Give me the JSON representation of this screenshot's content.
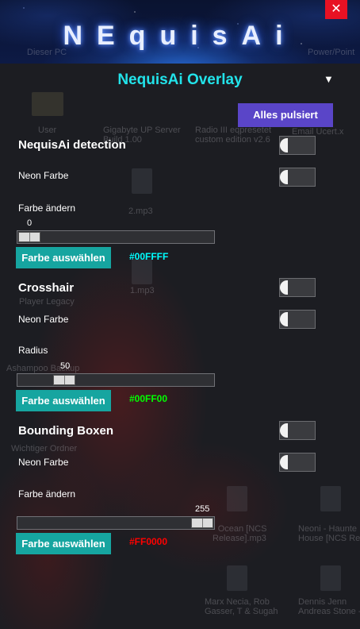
{
  "banner": {
    "logo_text": "NEquisAi",
    "close_symbol": "✕"
  },
  "desktop_ghosts": {
    "top_left": "Dieser PC",
    "top_right": "Power/Point",
    "user": "User",
    "server": "Gigabyte UP Server\nBuild 1.00",
    "radio": "Radio III eqpresetet\ncustom edition v2.6",
    "email": "Email Ucert.x",
    "player": "Player Legacy",
    "mp3_1": "2.mp3",
    "mp3_2": "1.mp3",
    "ashampoo": "Ashampoo Backup",
    "wichtig": "Wichtiger Ordner",
    "ncs1": "- Ocean [NCS\nRelease].mp3",
    "ncs2": "Neoni - Haunte\nHouse [NCS Re",
    "ncs3": "Marx Necia, Rob\nGasser, T & Sugah",
    "ncs4": "Dennis Jenn\nAndreas Stone - B"
  },
  "overlay": {
    "title": "NequisAi Overlay",
    "collapse_symbol": "▼",
    "pulse_button": "Alles pulsiert",
    "detection": {
      "heading": "NequisAi detection",
      "enabled": false,
      "neon_label": "Neon Farbe",
      "neon_enabled": false,
      "color_label": "Farbe ändern",
      "slider_value": "0",
      "slider_fraction": 0.0,
      "pick_button": "Farbe auswählen",
      "hex": "#00FFFF",
      "hex_color": "#00FFFF"
    },
    "crosshair": {
      "heading": "Crosshair",
      "enabled": false,
      "neon_label": "Neon Farbe",
      "neon_enabled": false,
      "radius_label": "Radius",
      "slider_value": "50",
      "slider_fraction": 0.2,
      "pick_button": "Farbe auswählen",
      "hex": "#00FF00",
      "hex_color": "#00FF00"
    },
    "boxes": {
      "heading": "Bounding Boxen",
      "enabled": false,
      "neon_label": "Neon Farbe",
      "neon_enabled": false,
      "color_label": "Farbe ändern",
      "slider_value": "255",
      "slider_fraction": 1.0,
      "pick_button": "Farbe auswählen",
      "hex": "#FF0000",
      "hex_color": "#FF0000"
    }
  }
}
